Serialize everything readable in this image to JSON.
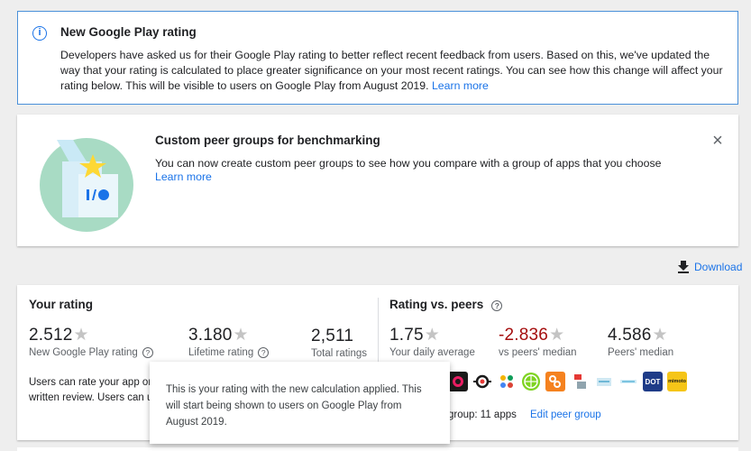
{
  "banner": {
    "title": "New Google Play rating",
    "text": "Developers have asked us for their Google Play rating to better reflect recent feedback from users. Based on this, we've updated the way that your rating is calculated to place greater significance on your most recent ratings. You can see how this change will affect your rating below. This will be visible to users on Google Play from August 2019.",
    "link": "Learn more"
  },
  "peer_card": {
    "title": "Custom peer groups for benchmarking",
    "text": "You can now create custom peer groups to see how you compare with a group of apps that you choose",
    "link": "Learn more",
    "illustration_text": "I/O"
  },
  "download_label": "Download",
  "your_rating": {
    "title": "Your rating",
    "metrics": [
      {
        "value": "2.512",
        "label": "New Google Play rating"
      },
      {
        "value": "3.180",
        "label": "Lifetime rating"
      },
      {
        "value": "2,511",
        "label": "Total ratings"
      }
    ],
    "users_text_line1": "Users can rate your app on G",
    "users_text_line2": "written review. Users can up"
  },
  "rating_vs_peers": {
    "title": "Rating vs. peers",
    "metrics": [
      {
        "value": "1.75",
        "label": "Your daily average"
      },
      {
        "value": "-2.836",
        "label": "vs peers' median"
      },
      {
        "value": "4.586",
        "label": "Peers' median"
      }
    ],
    "peer_group_text": "group: 11 apps",
    "edit_link": "Edit peer group",
    "apps": [
      {
        "name": "app-1",
        "color": "#1a1a1a",
        "label": ""
      },
      {
        "name": "app-2",
        "color": "#ffffff",
        "label": ""
      },
      {
        "name": "app-3",
        "color": "#ffffff",
        "label": ""
      },
      {
        "name": "app-4",
        "color": "#7ed321",
        "label": ""
      },
      {
        "name": "app-5",
        "color": "#f5821f",
        "label": ""
      },
      {
        "name": "app-6",
        "color": "#ffffff",
        "label": ""
      },
      {
        "name": "app-7",
        "color": "#ffffff",
        "label": ""
      },
      {
        "name": "app-8",
        "color": "#ffffff",
        "label": ""
      },
      {
        "name": "app-9",
        "color": "#1f3c88",
        "label": "DOT"
      },
      {
        "name": "app-10",
        "color": "#f5c518",
        "label": "mimoto"
      }
    ]
  },
  "tooltip": {
    "text": "This is your rating with the new calculation applied. This will start being shown to users on Google Play from August 2019."
  },
  "star_glyph": "★",
  "help_glyph": "?",
  "info_glyph": "i",
  "close_glyph": "×"
}
